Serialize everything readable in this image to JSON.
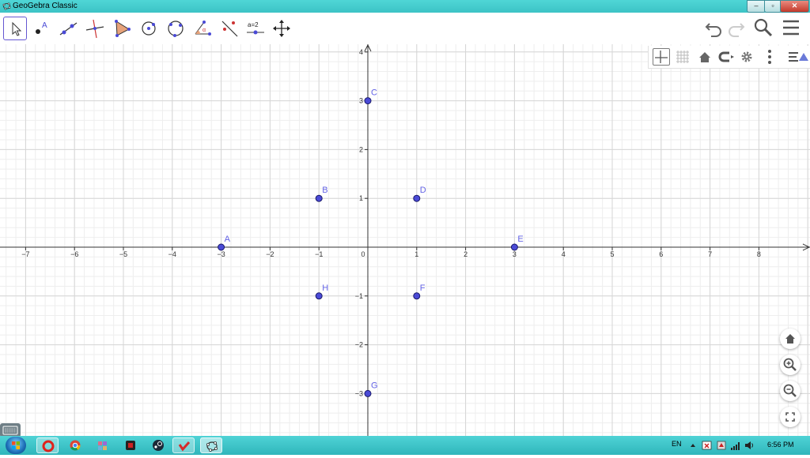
{
  "window": {
    "title": "GeoGebra Classic",
    "minimize": "–",
    "restore": "▫",
    "close": "✕"
  },
  "toolbar": {
    "tools": [
      {
        "name": "move-tool",
        "active": true
      },
      {
        "name": "point-tool",
        "label": "A"
      },
      {
        "name": "line-tool"
      },
      {
        "name": "perpendicular-line-tool"
      },
      {
        "name": "polygon-tool"
      },
      {
        "name": "circle-center-point-tool"
      },
      {
        "name": "circle-three-points-tool"
      },
      {
        "name": "angle-tool"
      },
      {
        "name": "reflect-tool"
      },
      {
        "name": "slider-tool",
        "label": "a=2"
      },
      {
        "name": "move-graphics-view-tool"
      }
    ],
    "right": [
      "undo-icon",
      "redo-icon",
      "search-icon",
      "menu-icon"
    ]
  },
  "graphics_style_bar": [
    "axes-toggle-icon",
    "grid-toggle-icon",
    "standard-view-icon",
    "point-capturing-icon",
    "settings-icon",
    "more-icon",
    "toggle-style-bar-icon"
  ],
  "graphics": {
    "x_ticks": [
      "−7",
      "−6",
      "−5",
      "−4",
      "−3",
      "−2",
      "−1",
      "0",
      "1",
      "2",
      "3",
      "4",
      "5",
      "6",
      "7",
      "8"
    ],
    "y_ticks": [
      "4",
      "3",
      "2",
      "1",
      "−1",
      "−2",
      "−3"
    ],
    "points": [
      {
        "label": "A",
        "x": -3,
        "y": 0
      },
      {
        "label": "B",
        "x": -1,
        "y": 1
      },
      {
        "label": "C",
        "x": 0,
        "y": 3
      },
      {
        "label": "D",
        "x": 1,
        "y": 1
      },
      {
        "label": "E",
        "x": 3,
        "y": 0
      },
      {
        "label": "F",
        "x": 1,
        "y": -1
      },
      {
        "label": "G",
        "x": 0,
        "y": -3
      },
      {
        "label": "H",
        "x": -1,
        "y": -1
      }
    ],
    "point_color": "#4a4ad6",
    "label_color": "#6464e6"
  },
  "zoom_panel": [
    "standard-view-icon",
    "zoom-in-icon",
    "zoom-out-icon",
    "fullscreen-icon"
  ],
  "taskbar": {
    "apps": [
      "opera-icon",
      "chrome-icon",
      "app-icon",
      "media-icon",
      "steam-icon",
      "app-red-icon",
      "geogebra-icon"
    ],
    "language": "EN",
    "time": "6:56 PM"
  }
}
